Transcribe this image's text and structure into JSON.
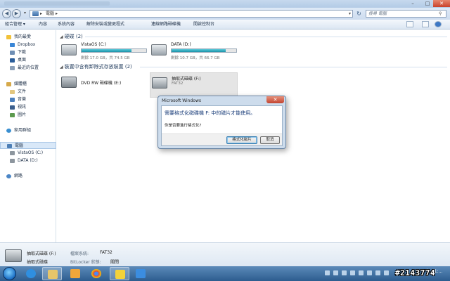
{
  "window": {
    "title_blur": ""
  },
  "address": {
    "crumbs": [
      "▸",
      "電腦",
      "▸"
    ],
    "search_placeholder": "搜尋 電腦"
  },
  "commandbar": {
    "items": [
      "組合管理 ▾",
      "內容",
      "系統內容",
      "解除安裝或變更程式",
      "連線網路磁碟機",
      "開啟控制台"
    ]
  },
  "nav": {
    "favorites": "我的最愛",
    "dropbox": "Dropbox",
    "downloads": "下載",
    "desktop": "桌面",
    "recent": "最近的位置",
    "libraries": "媒體櫃",
    "documents": "文件",
    "music": "音樂",
    "videos": "視訊",
    "pictures": "圖片",
    "homegroup": "家用群組",
    "computer": "電腦",
    "vista_drive": "VistaOS (C:)",
    "data_drive": "DATA (D:)",
    "network": "網路"
  },
  "content": {
    "hdd_group": "硬碟 (2)",
    "removable_group": "裝置中含有卸除式存放裝置 (2)",
    "drives": [
      {
        "name": "VistaOS (C:)",
        "free": "剩餘 17.0 GB，共 74.5 GB",
        "used_fraction": 0.77
      },
      {
        "name": "DATA (D:)",
        "free": "剩餘 10.7 GB，共 66.7 GB",
        "used_fraction": 0.84
      }
    ],
    "dvd": {
      "name": "DVD RW 磁碟機 (E:)"
    },
    "usb": {
      "name": "抽取式磁碟 (F:)",
      "fs": "FAT32"
    }
  },
  "dialog": {
    "title": "Microsoft Windows",
    "close": "✕",
    "message": "需要格式化磁碟機 F: 中的磁片才能使用。",
    "question": "你是否要進行格式化?",
    "format_button": "格式化磁片",
    "cancel_button": "取消"
  },
  "details": {
    "name": "抽取式磁碟 (F:)",
    "type": "抽取式磁碟",
    "fs_label": "檔案系統:",
    "fs_value": "FAT32",
    "bitlocker_label": "BitLocker 狀態:",
    "bitlocker_value": "關閉"
  },
  "taskbar": {
    "clock": "下午 01:..."
  },
  "watermark": "#2143774",
  "colors": {
    "accent": "#1c93a9",
    "taskbar": "#2d5d8f",
    "dialog_text": "#1c3f7b"
  }
}
